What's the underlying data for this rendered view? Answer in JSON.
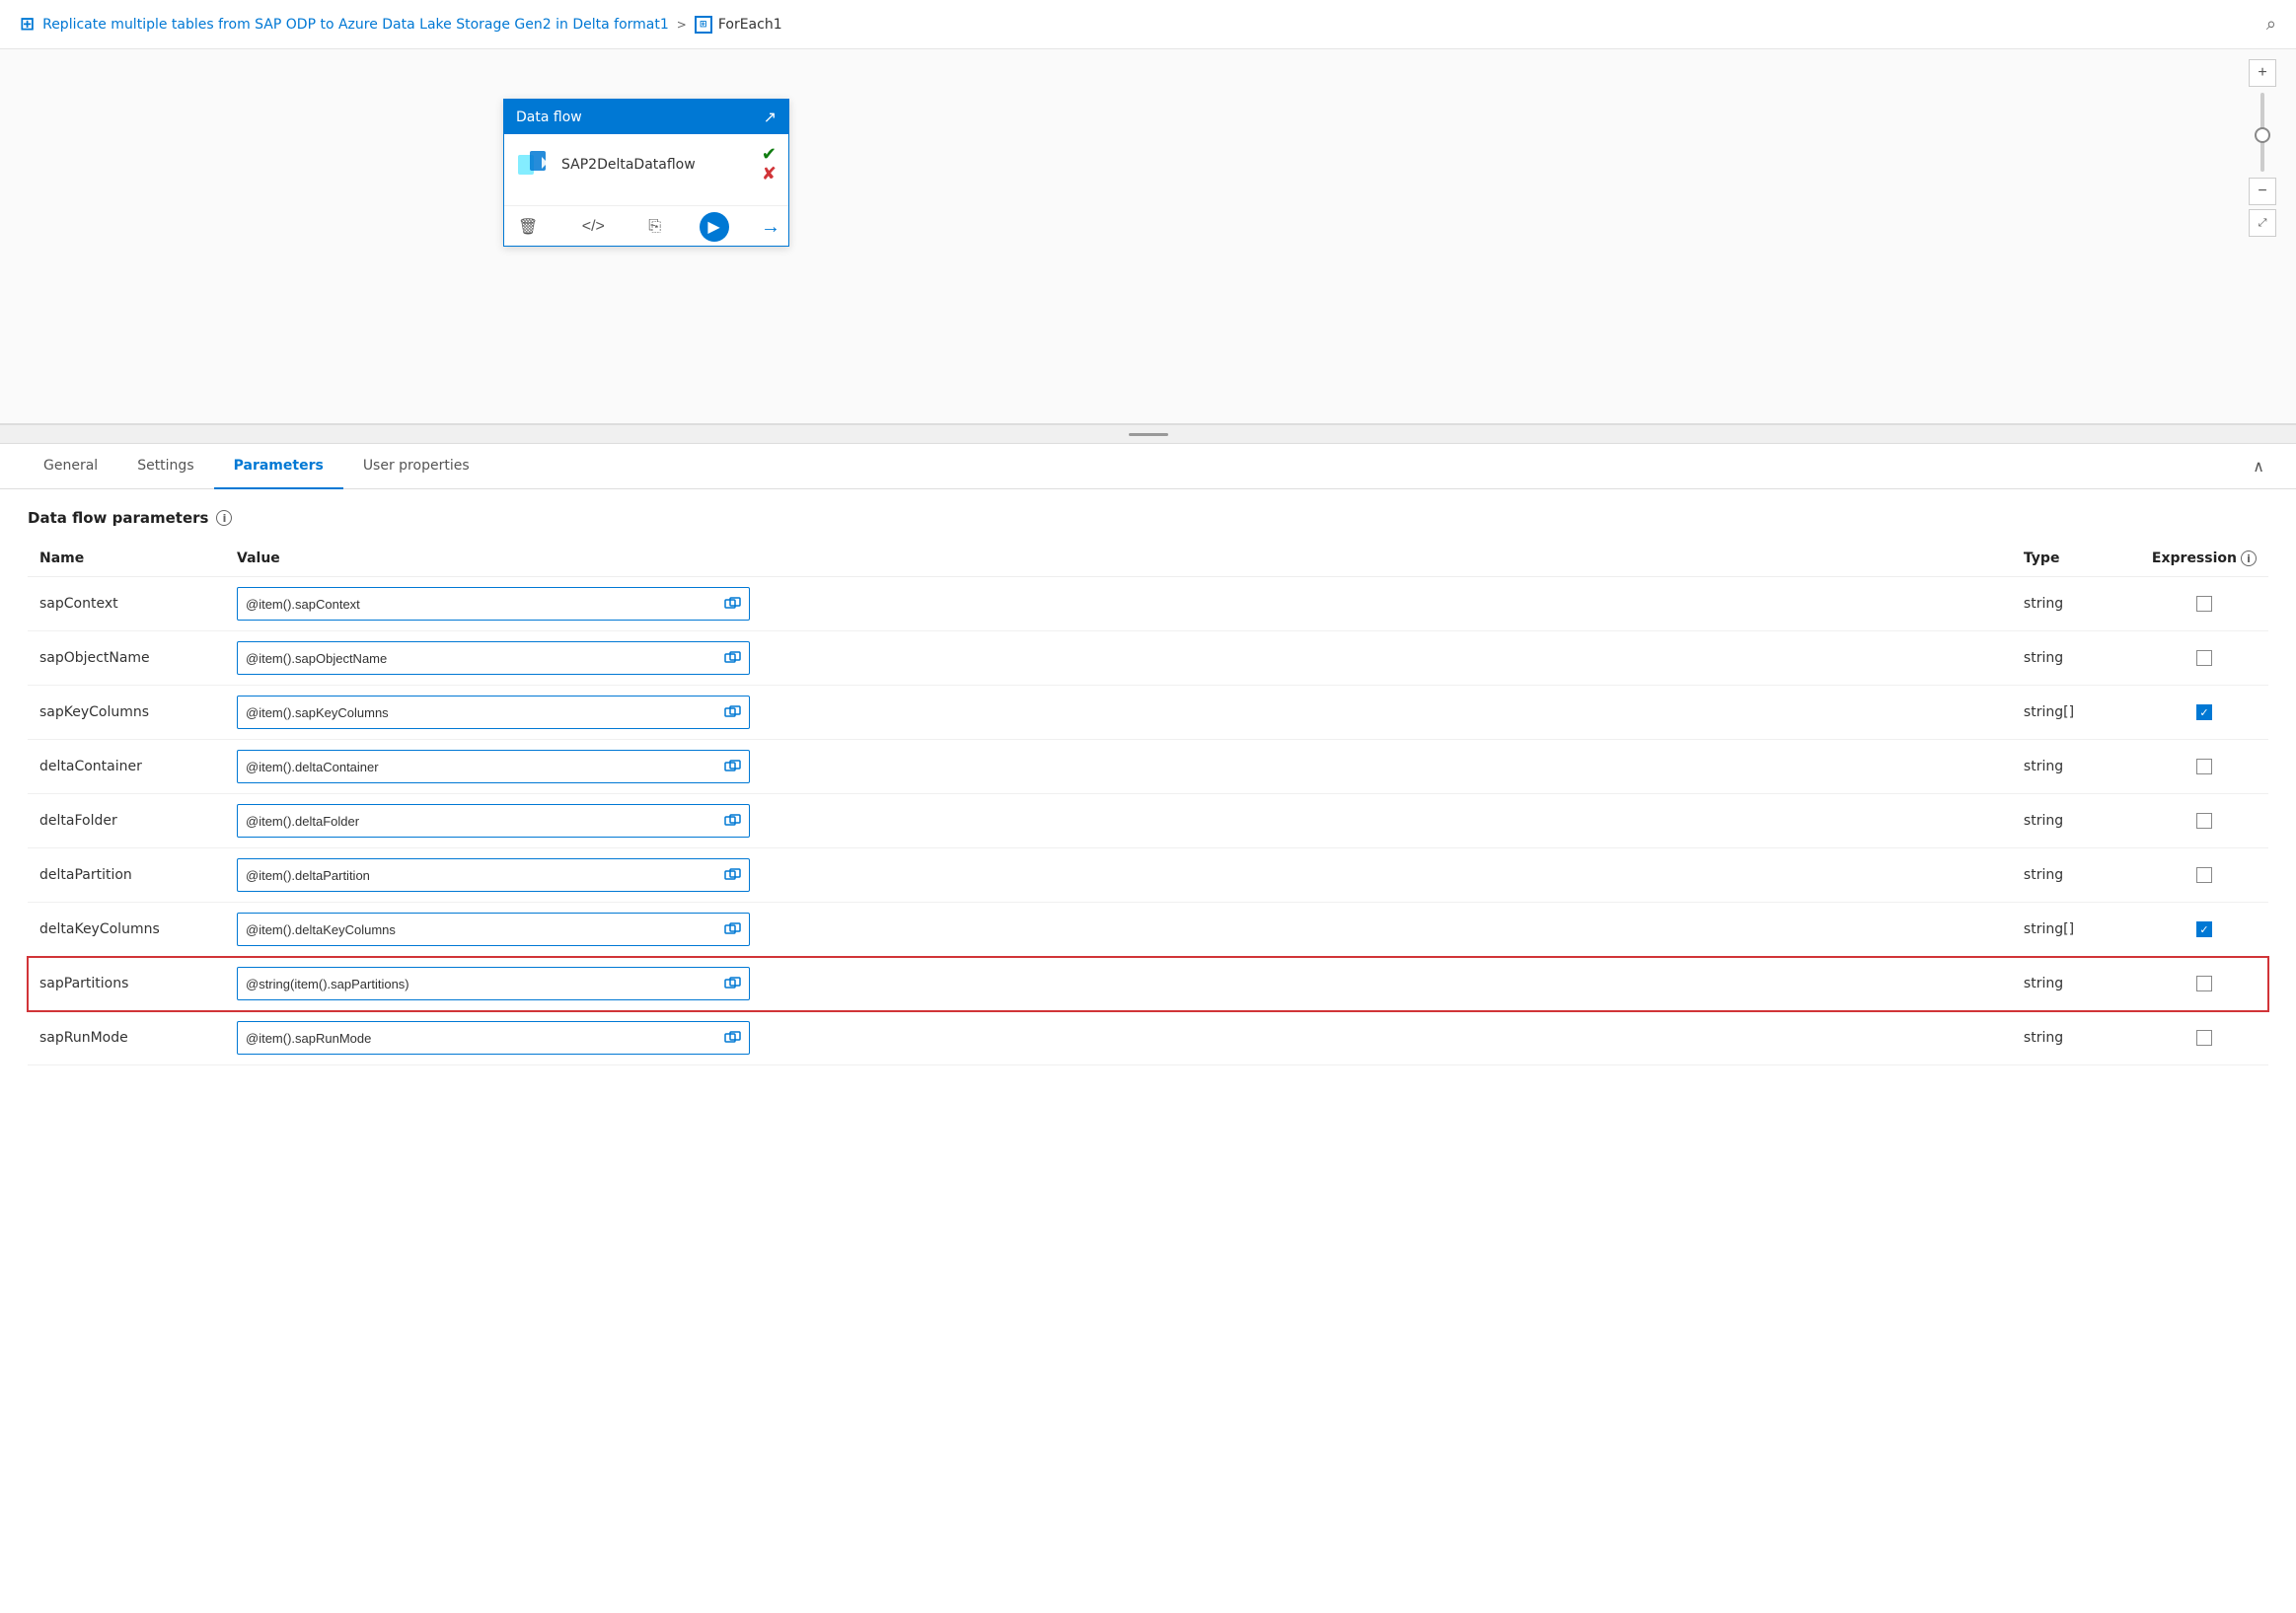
{
  "breadcrumb": {
    "icon": "⊞",
    "link_text": "Replicate multiple tables from SAP ODP to Azure Data Lake Storage Gen2 in Delta format1",
    "separator": ">",
    "current_icon": "ForEach",
    "current_text": "ForEach1"
  },
  "canvas": {
    "dataflow_card": {
      "header_title": "Data flow",
      "node_name": "SAP2DeltaDataflow",
      "external_link_icon": "⧉"
    },
    "zoom": {
      "plus": "+",
      "minus": "−",
      "fit": "⤢"
    }
  },
  "tabs": {
    "items": [
      {
        "label": "General",
        "active": false
      },
      {
        "label": "Settings",
        "active": false
      },
      {
        "label": "Parameters",
        "active": true
      },
      {
        "label": "User properties",
        "active": false
      }
    ],
    "collapse_icon": "∧"
  },
  "parameters_section": {
    "title": "Data flow parameters",
    "info_icon": "i",
    "columns": {
      "name": "Name",
      "value": "Value",
      "type": "Type",
      "expression": "Expression"
    },
    "rows": [
      {
        "name": "sapContext",
        "value": "@item().sapContext",
        "type": "string",
        "expression": false,
        "highlighted": false
      },
      {
        "name": "sapObjectName",
        "value": "@item().sapObjectName",
        "type": "string",
        "expression": false,
        "highlighted": false
      },
      {
        "name": "sapKeyColumns",
        "value": "@item().sapKeyColumns",
        "type": "string[]",
        "expression": true,
        "highlighted": false
      },
      {
        "name": "deltaContainer",
        "value": "@item().deltaContainer",
        "type": "string",
        "expression": false,
        "highlighted": false
      },
      {
        "name": "deltaFolder",
        "value": "@item().deltaFolder",
        "type": "string",
        "expression": false,
        "highlighted": false
      },
      {
        "name": "deltaPartition",
        "value": "@item().deltaPartition",
        "type": "string",
        "expression": false,
        "highlighted": false
      },
      {
        "name": "deltaKeyColumns",
        "value": "@item().deltaKeyColumns",
        "type": "string[]",
        "expression": true,
        "highlighted": false
      },
      {
        "name": "sapPartitions",
        "value": "@string(item().sapPartitions)",
        "type": "string",
        "expression": false,
        "highlighted": true
      },
      {
        "name": "sapRunMode",
        "value": "@item().sapRunMode",
        "type": "string",
        "expression": false,
        "highlighted": false
      }
    ]
  },
  "colors": {
    "blue": "#0078d4",
    "red": "#d13438",
    "green": "#107c10"
  }
}
